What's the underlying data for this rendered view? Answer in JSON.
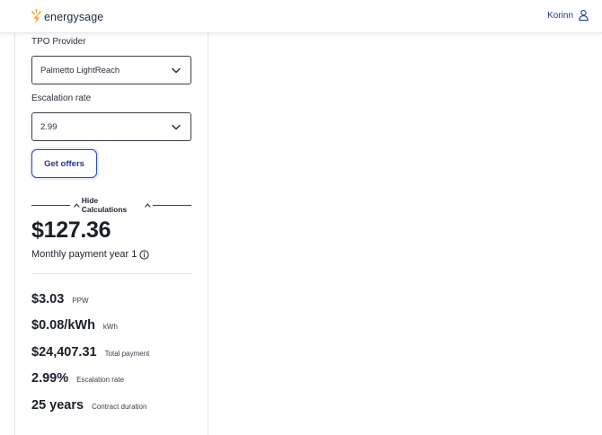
{
  "header": {
    "brand": "energysage",
    "user_name": "Korinn"
  },
  "form": {
    "tpo_label": "TPO Provider",
    "tpo_value": "Palmetto LightReach",
    "escalation_label": "Escalation rate",
    "escalation_value": "2.99",
    "offers_button": "Get offers"
  },
  "calculations": {
    "toggle_label": "Hide Calculations",
    "monthly_amount": "$127.36",
    "monthly_label": "Monthly payment year 1",
    "metrics": [
      {
        "value": "$3.03",
        "label": "PPW"
      },
      {
        "value": "$0.08/kWh",
        "label": "kWh"
      },
      {
        "value": "$24,407.31",
        "label": "Total payment"
      },
      {
        "value": "2.99%",
        "label": "Escalation rate"
      },
      {
        "value": "25 years",
        "label": "Contract duration"
      }
    ]
  },
  "colors": {
    "brand_orange": "#f5a623",
    "link_blue": "#1f3a8a"
  }
}
